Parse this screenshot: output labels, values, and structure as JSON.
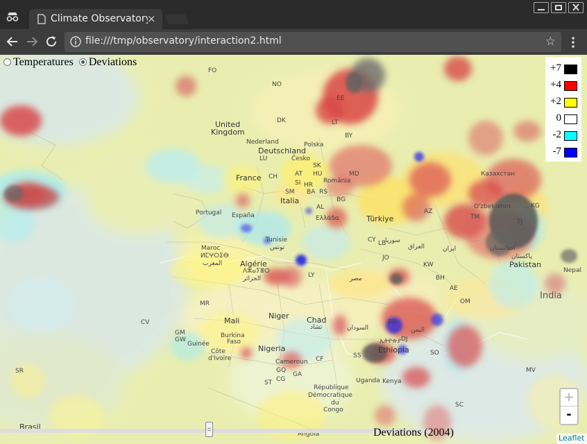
{
  "browser": {
    "tab_title": "Climate Observatory",
    "tab_close": "×",
    "url": "file:///tmp/observatory/interaction2.html",
    "star": "☆"
  },
  "controls": {
    "radio_temperatures": "Temperatures",
    "radio_deviations": "Deviations",
    "selected": "Deviations"
  },
  "legend": [
    {
      "label": "+7",
      "color": "#000000"
    },
    {
      "label": "+4",
      "color": "#ff0000"
    },
    {
      "label": "+2",
      "color": "#ffff00"
    },
    {
      "label": "0",
      "color": "#ffffff"
    },
    {
      "label": "-2",
      "color": "#00ffff"
    },
    {
      "label": "-7",
      "color": "#0000ff"
    }
  ],
  "zoom": {
    "in": "+",
    "out": "-"
  },
  "slider": {
    "label": "Deviations (2004)"
  },
  "attribution": "Leaflet",
  "map_labels": {
    "fo": "FO",
    "no": "NO",
    "ee": "EE",
    "lt": "LT",
    "dk": "DK",
    "by": "BY",
    "uk1": "United",
    "uk2": "Kingdom",
    "nl": "Nederland",
    "pl": "Polska",
    "de": "Deutschland",
    "lu": "LU",
    "cz": "Česko",
    "sk": "SK",
    "md": "MD",
    "fr": "France",
    "ch": "CH",
    "at": "AT",
    "hu": "HU",
    "ro": "România",
    "si": "SI",
    "hr": "HR",
    "sm": "SM",
    "ba": "BA",
    "rs": "RS",
    "it": "Italia",
    "bg": "BG",
    "pt": "Portugal",
    "es": "España",
    "al": "AL",
    "gr": "Ελλάδα",
    "tr": "Türkiye",
    "cy": "CY",
    "lb": "LB",
    "sy": "سوريا",
    "iq": "العراق",
    "jo": "JO",
    "ir": "ایران",
    "kw": "KW",
    "bh": "BH",
    "ae": "AE",
    "om": "OM",
    "kz": "Казахстан",
    "uz": "O'zbekiston",
    "tm": "TM",
    "kg": "KG",
    "tj": "TJ",
    "af": "افغانستان",
    "pk1": "پاکستان",
    "pk2": "Pakistan",
    "np": "Nepal",
    "in": "India",
    "az": "AZ",
    "ma1": "Maroc",
    "ma2": "ⵍⵎⵖⵔⵉⴱ",
    "ma3": "المغرب",
    "tn1": "Tunisie",
    "tn2": "تونس",
    "dz1": "Algérie",
    "dz2": "ⴷⵣⴰⵢⴻⵔ",
    "dz3": "الجزائر",
    "ly": "LY",
    "eg": "مصر",
    "mr": "MR",
    "ml": "Mali",
    "ne": "Niger",
    "td1": "Chad",
    "td2": "تشاد",
    "sd": "السودان",
    "er": "ER",
    "dj": "DJ",
    "et1": "ኢትዮጵያ",
    "et2": "Ethiopia",
    "so": "SO",
    "ss": "SS",
    "cv": "CV",
    "gm": "GM",
    "gw": "GW",
    "gn": "Guinée",
    "bf1": "Burkina",
    "bf2": "Faso",
    "ci1": "Côte",
    "ci2": "d'Ivoire",
    "ng": "Nigeria",
    "cm": "Cameroun",
    "cf": "CF",
    "st": "ST",
    "gq": "GQ",
    "ga": "GA",
    "cg": "CG",
    "cd1": "République",
    "cd2": "Démocratique",
    "cd3": "du",
    "cd4": "Congo",
    "ug": "Uganda",
    "ke": "Kenya",
    "ao": "Angola",
    "mv": "MV",
    "sc": "SC",
    "sr": "SR",
    "br": "Brasil",
    "ye": "اليمن"
  },
  "colors": {
    "tab_bg": "#3c3c3c",
    "titlebar": "#2b2b2b",
    "map_base": "#eef2b0"
  }
}
